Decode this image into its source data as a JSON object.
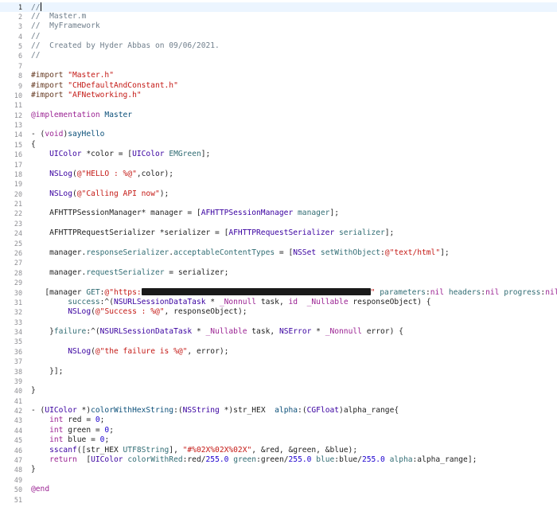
{
  "editor": {
    "file_name": "Master.m",
    "current_line": 1,
    "lines": [
      {
        "n": "1",
        "tokens": [
          {
            "t": "//",
            "c": "comment"
          }
        ]
      },
      {
        "n": "2",
        "tokens": [
          {
            "t": "//  Master.m",
            "c": "comment"
          }
        ]
      },
      {
        "n": "3",
        "tokens": [
          {
            "t": "//  MyFramework",
            "c": "comment"
          }
        ]
      },
      {
        "n": "4",
        "tokens": [
          {
            "t": "//",
            "c": "comment"
          }
        ]
      },
      {
        "n": "5",
        "tokens": [
          {
            "t": "//  Created by Hyder Abbas on 09/06/2021.",
            "c": "comment"
          }
        ]
      },
      {
        "n": "6",
        "tokens": [
          {
            "t": "//",
            "c": "comment"
          }
        ]
      },
      {
        "n": "7",
        "tokens": []
      },
      {
        "n": "8",
        "tokens": [
          {
            "t": "#import ",
            "c": "macro"
          },
          {
            "t": "\"Master.h\"",
            "c": "string"
          }
        ]
      },
      {
        "n": "9",
        "tokens": [
          {
            "t": "#import ",
            "c": "macro"
          },
          {
            "t": "\"CHDefaultAndConstant.h\"",
            "c": "string"
          }
        ]
      },
      {
        "n": "10",
        "tokens": [
          {
            "t": "#import ",
            "c": "macro"
          },
          {
            "t": "\"AFNetworking.h\"",
            "c": "string"
          }
        ]
      },
      {
        "n": "11",
        "tokens": []
      },
      {
        "n": "12",
        "tokens": [
          {
            "t": "@implementation",
            "c": "keyword"
          },
          {
            "t": " Master",
            "c": "type"
          }
        ]
      },
      {
        "n": "13",
        "tokens": []
      },
      {
        "n": "14",
        "tokens": [
          {
            "t": "- (",
            "c": "plain"
          },
          {
            "t": "void",
            "c": "keyword"
          },
          {
            "t": ")",
            "c": "plain"
          },
          {
            "t": "sayHello",
            "c": "type"
          }
        ]
      },
      {
        "n": "15",
        "tokens": [
          {
            "t": "{",
            "c": "plain"
          }
        ]
      },
      {
        "n": "16",
        "tokens": [
          {
            "t": "    ",
            "c": "plain"
          },
          {
            "t": "UIColor",
            "c": "class"
          },
          {
            "t": " *color = [",
            "c": "plain"
          },
          {
            "t": "UIColor",
            "c": "class"
          },
          {
            "t": " ",
            "c": "plain"
          },
          {
            "t": "EMGreen",
            "c": "method"
          },
          {
            "t": "];",
            "c": "plain"
          }
        ]
      },
      {
        "n": "17",
        "tokens": []
      },
      {
        "n": "18",
        "tokens": [
          {
            "t": "    ",
            "c": "plain"
          },
          {
            "t": "NSLog",
            "c": "class"
          },
          {
            "t": "(",
            "c": "plain"
          },
          {
            "t": "@\"HELLO : %@\"",
            "c": "string"
          },
          {
            "t": ",color);",
            "c": "plain"
          }
        ]
      },
      {
        "n": "19",
        "tokens": []
      },
      {
        "n": "20",
        "tokens": [
          {
            "t": "    ",
            "c": "plain"
          },
          {
            "t": "NSLog",
            "c": "class"
          },
          {
            "t": "(",
            "c": "plain"
          },
          {
            "t": "@\"Calling API now\"",
            "c": "string"
          },
          {
            "t": ");",
            "c": "plain"
          }
        ]
      },
      {
        "n": "21",
        "tokens": []
      },
      {
        "n": "22",
        "tokens": [
          {
            "t": "    AFHTTPSessionManager* manager = [",
            "c": "plain"
          },
          {
            "t": "AFHTTPSessionManager",
            "c": "class"
          },
          {
            "t": " ",
            "c": "plain"
          },
          {
            "t": "manager",
            "c": "method"
          },
          {
            "t": "];",
            "c": "plain"
          }
        ]
      },
      {
        "n": "23",
        "tokens": []
      },
      {
        "n": "24",
        "tokens": [
          {
            "t": "    AFHTTPRequestSerializer *serializer = [",
            "c": "plain"
          },
          {
            "t": "AFHTTPRequestSerializer",
            "c": "class"
          },
          {
            "t": " ",
            "c": "plain"
          },
          {
            "t": "serializer",
            "c": "method"
          },
          {
            "t": "];",
            "c": "plain"
          }
        ]
      },
      {
        "n": "25",
        "tokens": []
      },
      {
        "n": "26",
        "tokens": [
          {
            "t": "    manager.",
            "c": "plain"
          },
          {
            "t": "responseSerializer",
            "c": "method"
          },
          {
            "t": ".",
            "c": "plain"
          },
          {
            "t": "acceptableContentTypes",
            "c": "method"
          },
          {
            "t": " = [",
            "c": "plain"
          },
          {
            "t": "NSSet",
            "c": "class"
          },
          {
            "t": " ",
            "c": "plain"
          },
          {
            "t": "setWithObject",
            "c": "method"
          },
          {
            "t": ":",
            "c": "plain"
          },
          {
            "t": "@\"text/html\"",
            "c": "string"
          },
          {
            "t": "];",
            "c": "plain"
          }
        ]
      },
      {
        "n": "27",
        "tokens": []
      },
      {
        "n": "28",
        "tokens": [
          {
            "t": "    manager.",
            "c": "plain"
          },
          {
            "t": "requestSerializer",
            "c": "method"
          },
          {
            "t": " = serializer;",
            "c": "plain"
          }
        ]
      },
      {
        "n": "29",
        "tokens": []
      },
      {
        "n": "30",
        "tokens": [
          {
            "t": "   [manager ",
            "c": "plain"
          },
          {
            "t": "GET",
            "c": "method"
          },
          {
            "t": ":",
            "c": "plain"
          },
          {
            "t": "@\"https:",
            "c": "string"
          },
          {
            "t": "",
            "c": "redact",
            "w": 288
          },
          {
            "t": "\"",
            "c": "string"
          },
          {
            "t": " ",
            "c": "plain"
          },
          {
            "t": "parameters",
            "c": "method"
          },
          {
            "t": ":",
            "c": "plain"
          },
          {
            "t": "nil",
            "c": "keyword"
          },
          {
            "t": " ",
            "c": "plain"
          },
          {
            "t": "headers",
            "c": "method"
          },
          {
            "t": ":",
            "c": "plain"
          },
          {
            "t": "nil",
            "c": "keyword"
          },
          {
            "t": " ",
            "c": "plain"
          },
          {
            "t": "progress",
            "c": "method"
          },
          {
            "t": ":",
            "c": "plain"
          },
          {
            "t": "nil",
            "c": "keyword"
          }
        ]
      },
      {
        "n": "31",
        "tokens": [
          {
            "t": "        ",
            "c": "plain"
          },
          {
            "t": "success",
            "c": "method"
          },
          {
            "t": ":^(",
            "c": "plain"
          },
          {
            "t": "NSURLSessionDataTask",
            "c": "class"
          },
          {
            "t": " * ",
            "c": "plain"
          },
          {
            "t": "_Nonnull",
            "c": "keyword"
          },
          {
            "t": " task, ",
            "c": "plain"
          },
          {
            "t": "id",
            "c": "keyword"
          },
          {
            "t": "  ",
            "c": "plain"
          },
          {
            "t": "_Nullable",
            "c": "keyword"
          },
          {
            "t": " responseObject) {",
            "c": "plain"
          }
        ]
      },
      {
        "n": "32",
        "tokens": [
          {
            "t": "        ",
            "c": "plain"
          },
          {
            "t": "NSLog",
            "c": "class"
          },
          {
            "t": "(",
            "c": "plain"
          },
          {
            "t": "@\"Success : %@\"",
            "c": "string"
          },
          {
            "t": ", responseObject);",
            "c": "plain"
          }
        ]
      },
      {
        "n": "33",
        "tokens": []
      },
      {
        "n": "34",
        "tokens": [
          {
            "t": "    }",
            "c": "plain"
          },
          {
            "t": "failure",
            "c": "method"
          },
          {
            "t": ":^(",
            "c": "plain"
          },
          {
            "t": "NSURLSessionDataTask",
            "c": "class"
          },
          {
            "t": " * ",
            "c": "plain"
          },
          {
            "t": "_Nullable",
            "c": "keyword"
          },
          {
            "t": " task, ",
            "c": "plain"
          },
          {
            "t": "NSError",
            "c": "class"
          },
          {
            "t": " * ",
            "c": "plain"
          },
          {
            "t": "_Nonnull",
            "c": "keyword"
          },
          {
            "t": " error) {",
            "c": "plain"
          }
        ]
      },
      {
        "n": "35",
        "tokens": []
      },
      {
        "n": "36",
        "tokens": [
          {
            "t": "        ",
            "c": "plain"
          },
          {
            "t": "NSLog",
            "c": "class"
          },
          {
            "t": "(",
            "c": "plain"
          },
          {
            "t": "@\"the failure is %@\"",
            "c": "string"
          },
          {
            "t": ", error);",
            "c": "plain"
          }
        ]
      },
      {
        "n": "37",
        "tokens": []
      },
      {
        "n": "38",
        "tokens": [
          {
            "t": "    }];",
            "c": "plain"
          }
        ]
      },
      {
        "n": "39",
        "tokens": []
      },
      {
        "n": "40",
        "tokens": [
          {
            "t": "}",
            "c": "plain"
          }
        ]
      },
      {
        "n": "41",
        "tokens": []
      },
      {
        "n": "42",
        "tokens": [
          {
            "t": "- (",
            "c": "plain"
          },
          {
            "t": "UIColor",
            "c": "class"
          },
          {
            "t": " *)",
            "c": "plain"
          },
          {
            "t": "colorWithHexString",
            "c": "type"
          },
          {
            "t": ":(",
            "c": "plain"
          },
          {
            "t": "NSString",
            "c": "class"
          },
          {
            "t": " *)str_HEX  ",
            "c": "plain"
          },
          {
            "t": "alpha",
            "c": "type"
          },
          {
            "t": ":(",
            "c": "plain"
          },
          {
            "t": "CGFloat",
            "c": "class"
          },
          {
            "t": ")alpha_range{",
            "c": "plain"
          }
        ]
      },
      {
        "n": "43",
        "tokens": [
          {
            "t": "    ",
            "c": "plain"
          },
          {
            "t": "int",
            "c": "keyword"
          },
          {
            "t": " red = ",
            "c": "plain"
          },
          {
            "t": "0",
            "c": "number"
          },
          {
            "t": ";",
            "c": "plain"
          }
        ]
      },
      {
        "n": "44",
        "tokens": [
          {
            "t": "    ",
            "c": "plain"
          },
          {
            "t": "int",
            "c": "keyword"
          },
          {
            "t": " green = ",
            "c": "plain"
          },
          {
            "t": "0",
            "c": "number"
          },
          {
            "t": ";",
            "c": "plain"
          }
        ]
      },
      {
        "n": "45",
        "tokens": [
          {
            "t": "    ",
            "c": "plain"
          },
          {
            "t": "int",
            "c": "keyword"
          },
          {
            "t": " blue = ",
            "c": "plain"
          },
          {
            "t": "0",
            "c": "number"
          },
          {
            "t": ";",
            "c": "plain"
          }
        ]
      },
      {
        "n": "46",
        "tokens": [
          {
            "t": "    ",
            "c": "plain"
          },
          {
            "t": "sscanf",
            "c": "class"
          },
          {
            "t": "([str_HEX ",
            "c": "plain"
          },
          {
            "t": "UTF8String",
            "c": "method"
          },
          {
            "t": "], ",
            "c": "plain"
          },
          {
            "t": "\"#%02X%02X%02X\"",
            "c": "string"
          },
          {
            "t": ", &red, &green, &blue);",
            "c": "plain"
          }
        ]
      },
      {
        "n": "47",
        "tokens": [
          {
            "t": "    ",
            "c": "plain"
          },
          {
            "t": "return",
            "c": "keyword"
          },
          {
            "t": "  [",
            "c": "plain"
          },
          {
            "t": "UIColor",
            "c": "class"
          },
          {
            "t": " ",
            "c": "plain"
          },
          {
            "t": "colorWithRed",
            "c": "method"
          },
          {
            "t": ":red/",
            "c": "plain"
          },
          {
            "t": "255.0",
            "c": "number"
          },
          {
            "t": " ",
            "c": "plain"
          },
          {
            "t": "green",
            "c": "method"
          },
          {
            "t": ":green/",
            "c": "plain"
          },
          {
            "t": "255.0",
            "c": "number"
          },
          {
            "t": " ",
            "c": "plain"
          },
          {
            "t": "blue",
            "c": "method"
          },
          {
            "t": ":blue/",
            "c": "plain"
          },
          {
            "t": "255.0",
            "c": "number"
          },
          {
            "t": " ",
            "c": "plain"
          },
          {
            "t": "alpha",
            "c": "method"
          },
          {
            "t": ":alpha_range];",
            "c": "plain"
          }
        ]
      },
      {
        "n": "48",
        "tokens": [
          {
            "t": "}",
            "c": "plain"
          }
        ]
      },
      {
        "n": "49",
        "tokens": []
      },
      {
        "n": "50",
        "tokens": [
          {
            "t": "@end",
            "c": "keyword"
          }
        ]
      },
      {
        "n": "51",
        "tokens": []
      }
    ]
  },
  "colors": {
    "comment": "#707f8c",
    "keyword": "#9b2393",
    "string": "#c41a16",
    "type": "#0b4f79",
    "method": "#326d74",
    "class": "#3900a0",
    "macro": "#643820",
    "number": "#1c00cf",
    "current_line_highlight": "#ecf5ff"
  }
}
